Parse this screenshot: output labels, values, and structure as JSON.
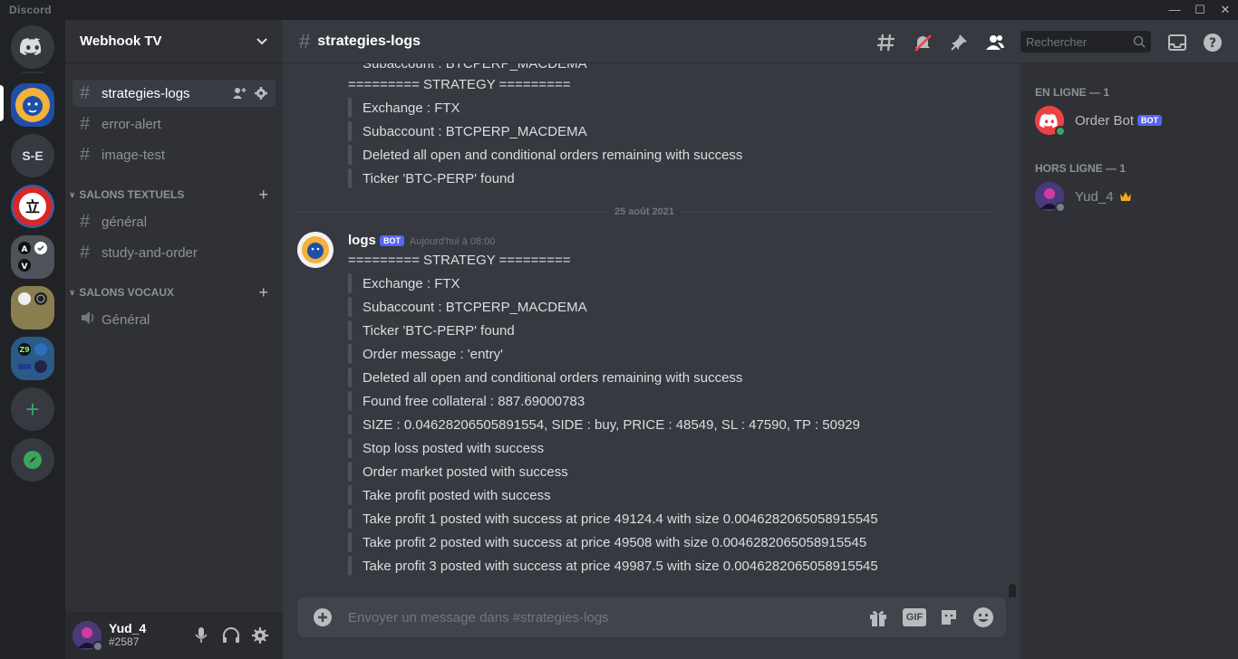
{
  "app": {
    "title": "Discord"
  },
  "window_controls": [
    "—",
    "☐",
    "✕"
  ],
  "servers": [
    {
      "label": "",
      "icon": "discord-home-icon",
      "color": "#36393f"
    },
    {
      "label": "",
      "icon": "lion-server-icon",
      "color": "#1f4ea8"
    },
    {
      "label": "S-E",
      "icon": "",
      "color": "#36393f"
    },
    {
      "label": "立",
      "icon": "sign-server-icon",
      "color": "#1e66b4"
    },
    {
      "label": "",
      "icon": "folder-icon",
      "color": "#4f545c"
    },
    {
      "label": "",
      "icon": "folder-icon",
      "color": "#8a7d50"
    },
    {
      "label": "",
      "icon": "folder-icon",
      "color": "#2a5a88"
    },
    {
      "label": "+",
      "icon": "add-server-icon",
      "color": "#36393f"
    },
    {
      "label": "",
      "icon": "compass-icon",
      "color": "#36393f"
    }
  ],
  "guild": {
    "name": "Webhook TV"
  },
  "channels": {
    "top": [
      {
        "name": "strategies-logs",
        "active": true
      },
      {
        "name": "error-alert",
        "active": false
      },
      {
        "name": "image-test",
        "active": false
      }
    ],
    "text_category": "SALONS TEXTUELS",
    "text_channels": [
      "général",
      "study-and-order"
    ],
    "voice_category": "SALONS VOCAUX",
    "voice_channels": [
      "Général"
    ]
  },
  "user": {
    "name": "Yud_4",
    "tag": "#2587"
  },
  "header": {
    "channel": "strategies-logs",
    "search_placeholder": "Rechercher"
  },
  "messages": {
    "prev_lines": [
      "Subaccount : BTCPERP_MACDEMA",
      "========= STRATEGY =========",
      "Exchange : FTX",
      "Subaccount : BTCPERP_MACDEMA",
      "Deleted all open and conditional orders remaining with success",
      "Ticker 'BTC-PERP' found"
    ],
    "date_divider": "25 août 2021",
    "author": "logs",
    "bot_badge": "BOT",
    "timestamp": "Aujourd'hui à 08:00",
    "lines": [
      "========= STRATEGY =========",
      "Exchange : FTX",
      "Subaccount : BTCPERP_MACDEMA",
      "Ticker 'BTC-PERP' found",
      "Order message : 'entry'",
      "Deleted all open and conditional orders remaining with success",
      "Found free collateral : 887.69000783",
      "SIZE : 0.04628206505891554, SIDE : buy, PRICE : 48549, SL : 47590, TP : 50929",
      "Stop loss posted with success",
      "Order market posted with success",
      "Take profit posted with success",
      "Take profit 1 posted with success at price 49124.4 with size 0.0046282065058915545",
      "Take profit 2 posted with success at price 49508 with size 0.0046282065058915545",
      "Take profit 3 posted with success at price 49987.5 with size 0.0046282065058915545"
    ]
  },
  "composer": {
    "placeholder": "Envoyer un message dans #strategies-logs",
    "gif_label": "GIF"
  },
  "members": {
    "online_header": "EN LIGNE — 1",
    "offline_header": "HORS LIGNE — 1",
    "online": [
      {
        "name": "Order Bot",
        "badge": "BOT",
        "status": "online",
        "status_color": "#3ba55d"
      }
    ],
    "offline": [
      {
        "name": "Yud_4",
        "status": "offline",
        "status_color": "#747f8d"
      }
    ]
  }
}
